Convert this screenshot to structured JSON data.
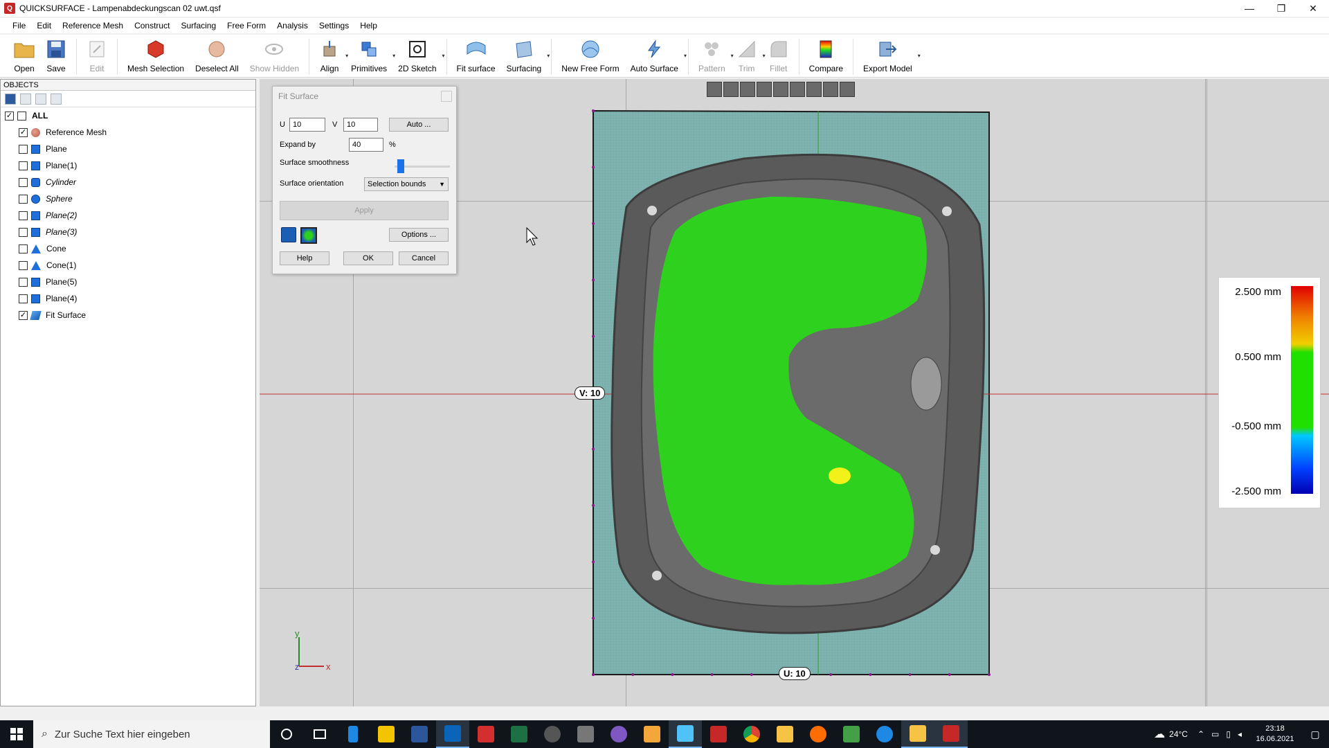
{
  "window": {
    "app_icon": "Q",
    "title": "QUICKSURFACE - Lampenabdeckungscan 02 uwt.qsf",
    "minimize": "—",
    "restore": "❐",
    "close": "✕"
  },
  "menu": [
    "File",
    "Edit",
    "Reference Mesh",
    "Construct",
    "Surfacing",
    "Free Form",
    "Analysis",
    "Settings",
    "Help"
  ],
  "toolbar": {
    "open": "Open",
    "save": "Save",
    "edit": "Edit",
    "mesh_selection": "Mesh Selection",
    "deselect_all": "Deselect All",
    "show_hidden": "Show Hidden",
    "align": "Align",
    "primitives": "Primitives",
    "sketch_2d": "2D Sketch",
    "fit_surface": "Fit surface",
    "surfacing": "Surfacing",
    "new_free_form": "New Free Form",
    "auto_surface": "Auto Surface",
    "pattern": "Pattern",
    "trim": "Trim",
    "fillet": "Fillet",
    "compare": "Compare",
    "export_model": "Export Model",
    "dropdown": "▾"
  },
  "objects": {
    "header": "OBJECTS",
    "root": "ALL",
    "items": [
      {
        "label": "Reference Mesh",
        "checked": "✓",
        "italic": false
      },
      {
        "label": "Plane",
        "checked": "",
        "italic": false
      },
      {
        "label": "Plane(1)",
        "checked": "",
        "italic": false
      },
      {
        "label": "Cylinder",
        "checked": "",
        "italic": true
      },
      {
        "label": "Sphere",
        "checked": "",
        "italic": true
      },
      {
        "label": "Plane(2)",
        "checked": "",
        "italic": true
      },
      {
        "label": "Plane(3)",
        "checked": "",
        "italic": true
      },
      {
        "label": "Cone",
        "checked": "",
        "italic": false
      },
      {
        "label": "Cone(1)",
        "checked": "",
        "italic": false
      },
      {
        "label": "Plane(5)",
        "checked": "",
        "italic": false
      },
      {
        "label": "Plane(4)",
        "checked": "",
        "italic": false
      },
      {
        "label": "Fit Surface",
        "checked": "✓",
        "italic": false
      }
    ]
  },
  "dialog": {
    "title": "Fit Surface",
    "u_label": "U",
    "u_value": "10",
    "v_label": "V",
    "v_value": "10",
    "auto_button": "Auto ...",
    "expand_label": "Expand by",
    "expand_value": "40",
    "expand_unit": "%",
    "smoothness_label": "Surface smoothness",
    "smoothness_level": 0.05,
    "orientation_label": "Surface orientation",
    "orientation_value": "Selection bounds",
    "apply_button": "Apply",
    "options_button": "Options ...",
    "help_button": "Help",
    "ok_button": "OK",
    "cancel_button": "Cancel"
  },
  "viewport": {
    "v_label": "V: 10",
    "u_label": "U: 10",
    "axis_x": "x",
    "axis_y": "y",
    "axis_z": "z"
  },
  "legend": {
    "max": "2.500 mm",
    "upper": "0.500 mm",
    "lower": "-0.500 mm",
    "min": "-2.500 mm"
  },
  "taskbar": {
    "search_placeholder": "Zur Suche Text hier eingeben",
    "temperature": "24°C",
    "time": "23:18",
    "date": "16.06.2021"
  }
}
